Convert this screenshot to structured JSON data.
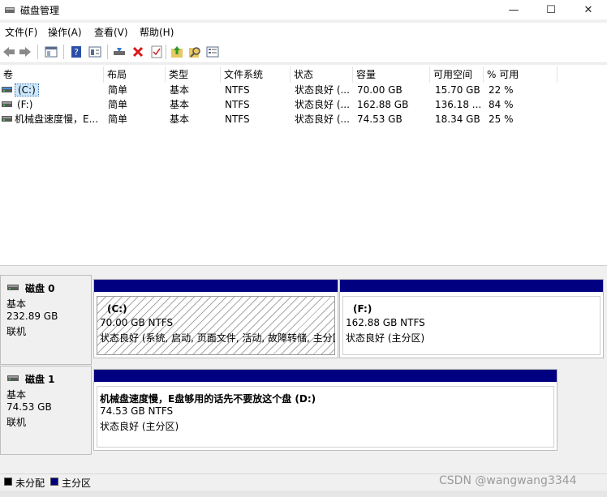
{
  "window": {
    "title": "磁盘管理",
    "controls": {
      "minimize": "—",
      "maximize": "☐",
      "close": "✕"
    }
  },
  "menu": {
    "file": "文件(F)",
    "action": "操作(A)",
    "view": "查看(V)",
    "help": "帮助(H)"
  },
  "toolbar": {
    "icons": [
      "back-icon",
      "forward-icon",
      "show-hide-console-tree-icon",
      "help-icon",
      "properties-icon",
      "connect-drive-icon",
      "delete-icon",
      "check-icon",
      "open-folder-icon",
      "search-icon",
      "list-view-icon"
    ]
  },
  "volume_list": {
    "columns": [
      "卷",
      "布局",
      "类型",
      "文件系统",
      "状态",
      "容量",
      "可用空间",
      "% 可用"
    ],
    "rows": [
      {
        "volume": "(C:)",
        "layout": "简单",
        "type": "基本",
        "fs": "NTFS",
        "status": "状态良好 (...",
        "capacity": "70.00 GB",
        "free": "15.70 GB",
        "pct": "22 %",
        "selected": true
      },
      {
        "volume": "(F:)",
        "layout": "简单",
        "type": "基本",
        "fs": "NTFS",
        "status": "状态良好 (...",
        "capacity": "162.88 GB",
        "free": "136.18 ...",
        "pct": "84 %",
        "selected": false
      },
      {
        "volume": "机械盘速度慢，E...",
        "layout": "简单",
        "type": "基本",
        "fs": "NTFS",
        "status": "状态良好 (...",
        "capacity": "74.53 GB",
        "free": "18.34 GB",
        "pct": "25 %",
        "selected": false
      }
    ]
  },
  "disks": [
    {
      "name": "磁盘 0",
      "type": "基本",
      "size": "232.89 GB",
      "state": "联机",
      "partitions": [
        {
          "label": "(C:)",
          "size_fs": "70.00 GB NTFS",
          "status": "状态良好 (系统, 启动, 页面文件, 活动, 故障转储, 主分区)",
          "hatched": true
        },
        {
          "label": "(F:)",
          "size_fs": "162.88 GB NTFS",
          "status": "状态良好 (主分区)",
          "hatched": false
        }
      ]
    },
    {
      "name": "磁盘 1",
      "type": "基本",
      "size": "74.53 GB",
      "state": "联机",
      "partitions": [
        {
          "label": "机械盘速度慢，E盘够用的话先不要放这个盘  (D:)",
          "size_fs": "74.53 GB NTFS",
          "status": "状态良好 (主分区)",
          "hatched": false
        }
      ]
    }
  ],
  "legend": {
    "unallocated": "未分配",
    "primary": "主分区",
    "colors": {
      "unallocated": "#000000",
      "primary": "#000080"
    }
  },
  "watermark": "CSDN @wangwang3344"
}
